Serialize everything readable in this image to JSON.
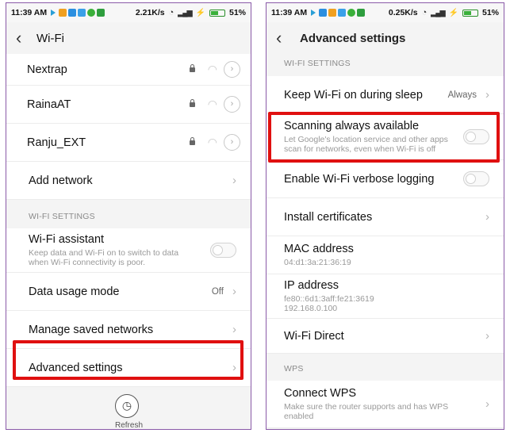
{
  "colors": {
    "accent_red": "#e01010",
    "panel_border": "#8a5aa8",
    "battery_green": "#3ab03a"
  },
  "left": {
    "status": {
      "time": "11:39 AM",
      "speed": "2.21K/s",
      "battery": "51%",
      "battery_level": 0.51
    },
    "title": "Wi-Fi",
    "networks": [
      {
        "name": "Nextrap"
      },
      {
        "name": "RainaAT"
      },
      {
        "name": "Ranju_EXT"
      }
    ],
    "add_network": "Add network",
    "section_header": "WI-FI SETTINGS",
    "wifi_assistant": {
      "label": "Wi-Fi assistant",
      "description": "Keep data and Wi-Fi on to switch to data when Wi-Fi connectivity is poor.",
      "enabled": false
    },
    "data_usage": {
      "label": "Data usage mode",
      "value": "Off"
    },
    "manage_saved": "Manage saved networks",
    "advanced": "Advanced settings",
    "refresh_label": "Refresh"
  },
  "right": {
    "status": {
      "time": "11:39 AM",
      "speed": "0.25K/s",
      "battery": "51%",
      "battery_level": 0.51
    },
    "title": "Advanced settings",
    "section_wifi": "WI-FI SETTINGS",
    "keep_wifi": {
      "label": "Keep Wi-Fi on during sleep",
      "value": "Always"
    },
    "scanning": {
      "label": "Scanning always available",
      "description": "Let Google's location service and other apps scan for networks, even when Wi-Fi is off",
      "enabled": false
    },
    "verbose": {
      "label": "Enable Wi-Fi verbose logging",
      "enabled": false
    },
    "install_certs": "Install certificates",
    "mac": {
      "label": "MAC address",
      "value": "04:d1:3a:21:36:19"
    },
    "ip": {
      "label": "IP address",
      "value_v6": "fe80::6d1:3aff:fe21:3619",
      "value_v4": "192.168.0.100"
    },
    "wifi_direct": "Wi-Fi Direct",
    "section_wps": "WPS",
    "connect_wps": {
      "label": "Connect WPS",
      "description": "Make sure the router supports and has WPS enabled"
    }
  }
}
